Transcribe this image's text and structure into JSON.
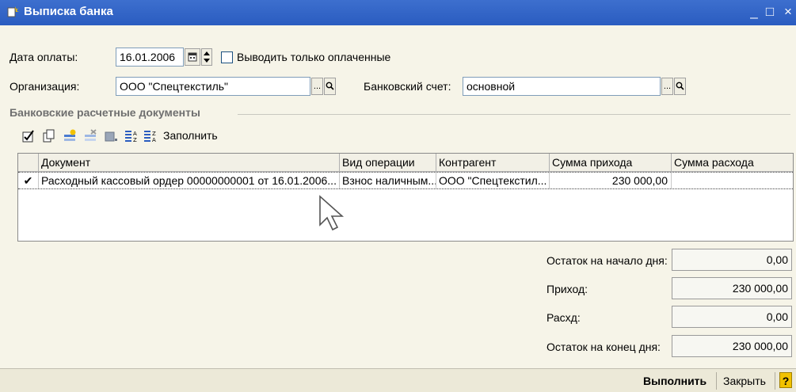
{
  "window": {
    "title": "Выписка банка",
    "minimize": "_",
    "maximize": "□",
    "close": "×"
  },
  "form": {
    "payment_date_label": "Дата оплаты:",
    "payment_date_value": "16.01.2006",
    "only_paid_label": "Выводить только оплаченные",
    "only_paid_checked": false,
    "organization_label": "Организация:",
    "organization_value": "ООО \"Спецтекстиль\"",
    "bank_account_label": "Банковский счет:",
    "bank_account_value": "основной",
    "select_button": "...",
    "open_button": "🔍"
  },
  "section": {
    "title": "Банковские расчетные документы"
  },
  "toolbar": {
    "fill_label": "Заполнить"
  },
  "table": {
    "columns": [
      "Документ",
      "Вид операции",
      "Контрагент",
      "Сумма прихода",
      "Сумма расхода"
    ],
    "rows": [
      {
        "check": "✔",
        "document": "Расходный кассовый ордер 00000000001 от 16.01.2006...",
        "operation": "Взнос наличным...",
        "counterparty": "ООО \"Спецтекстил...",
        "income": "230 000,00",
        "expense": ""
      }
    ]
  },
  "totals": {
    "start_label": "Остаток на начало дня:",
    "start_value": "0,00",
    "income_label": "Приход:",
    "income_value": "230 000,00",
    "expense_label": "Расхд:",
    "expense_value": "0,00",
    "end_label": "Остаток на конец дня:",
    "end_value": "230 000,00"
  },
  "buttons": {
    "execute": "Выполнить",
    "close": "Закрыть",
    "help": "?"
  },
  "colors": {
    "titlebar": "#2a5cc0",
    "window_bg": "#f6f4e8"
  }
}
